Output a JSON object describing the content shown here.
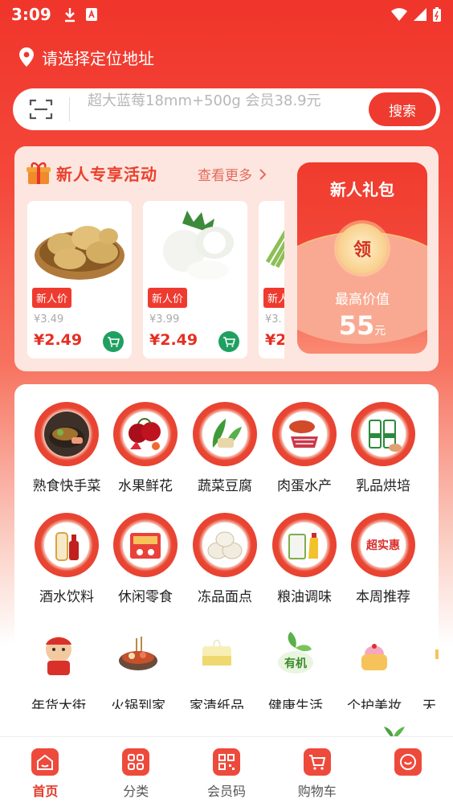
{
  "status_bar": {
    "time": "3:09"
  },
  "location": {
    "label": "请选择定位地址"
  },
  "search": {
    "placeholder": "超大蓝莓18mm+500g 会员38.9元",
    "button": "搜索"
  },
  "promo": {
    "title": "新人专享活动",
    "more": "查看更多",
    "products": [
      {
        "badge": "新人价",
        "old_price": "¥3.49",
        "price": "¥2.49"
      },
      {
        "badge": "新人价",
        "old_price": "¥3.99",
        "price": "¥2.49"
      },
      {
        "badge": "新人",
        "old_price": "¥3.",
        "price": "¥2"
      }
    ],
    "gift_pack": {
      "title": "新人礼包",
      "coin": "领",
      "label": "最高价值",
      "value": "55",
      "unit": "元"
    }
  },
  "categories": [
    {
      "label": "熟食快手菜",
      "icon": "hotpot-dishes-icon"
    },
    {
      "label": "水果鲜花",
      "icon": "cherry-fruit-icon"
    },
    {
      "label": "蔬菜豆腐",
      "icon": "vegetables-icon"
    },
    {
      "label": "肉蛋水产",
      "icon": "meat-seafood-icon"
    },
    {
      "label": "乳品烘培",
      "icon": "milk-bakery-icon"
    },
    {
      "label": "酒水饮料",
      "icon": "drinks-icon"
    },
    {
      "label": "休闲零食",
      "icon": "snacks-icon"
    },
    {
      "label": "冻品面点",
      "icon": "dumplings-icon"
    },
    {
      "label": "粮油调味",
      "icon": "oil-seasoning-icon"
    },
    {
      "label": "本周推荐",
      "icon": "weekly-deal-icon",
      "inner_text": "超实惠"
    },
    {
      "label": "年货大街",
      "icon": "new-year-goods-icon"
    },
    {
      "label": "火锅到家",
      "icon": "hotpot-icon"
    },
    {
      "label": "家清纸品",
      "icon": "tissue-icon"
    },
    {
      "label": "健康生活",
      "icon": "organic-icon",
      "inner_text": "有机"
    },
    {
      "label": "个护美妆",
      "icon": "cosmetics-icon"
    },
    {
      "label": "天",
      "icon": "partial-icon"
    }
  ],
  "tabbar": [
    {
      "label": "首页",
      "icon": "home-icon",
      "active": true
    },
    {
      "label": "分类",
      "icon": "category-icon"
    },
    {
      "label": "会员码",
      "icon": "qr-code-icon"
    },
    {
      "label": "购物车",
      "icon": "cart-icon"
    },
    {
      "label": "",
      "icon": "profile-icon"
    }
  ],
  "colors": {
    "primary": "#ef3b2f",
    "cart_green": "#1fa060"
  }
}
